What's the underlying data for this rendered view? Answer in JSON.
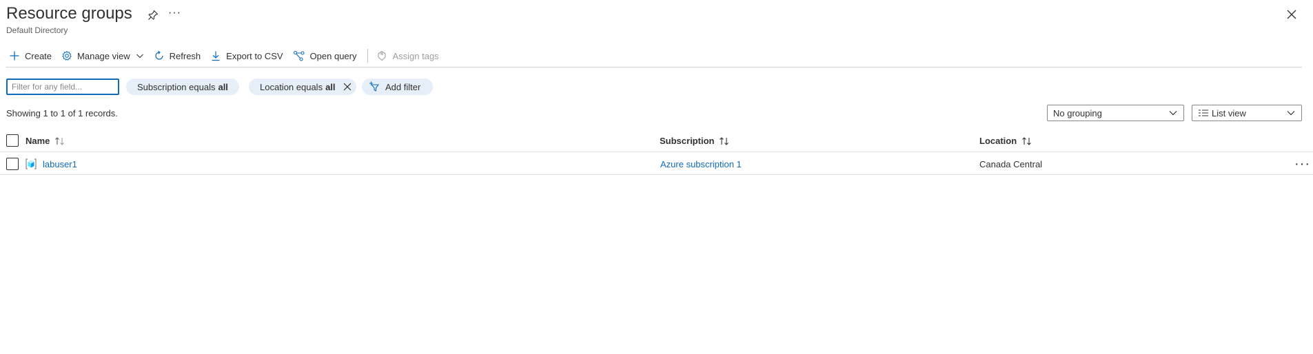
{
  "header": {
    "title": "Resource groups",
    "subtitle": "Default Directory",
    "more_label": "···"
  },
  "toolbar": {
    "create": "Create",
    "manage_view": "Manage view",
    "refresh": "Refresh",
    "export_csv": "Export to CSV",
    "open_query": "Open query",
    "assign_tags": "Assign tags"
  },
  "filters": {
    "search_placeholder": "Filter for any field...",
    "subscription_prefix": "Subscription equals",
    "subscription_value": "all",
    "location_prefix": "Location equals",
    "location_value": "all",
    "add_filter": "Add filter"
  },
  "records_text": "Showing 1 to 1 of 1 records.",
  "grouping": {
    "selected": "No grouping"
  },
  "view": {
    "selected": "List view"
  },
  "table": {
    "columns": [
      "Name",
      "Subscription",
      "Location"
    ],
    "rows": [
      {
        "name": "labuser1",
        "subscription": "Azure subscription 1",
        "location": "Canada Central"
      }
    ]
  },
  "row_more_label": "···",
  "colors": {
    "accent": "#0f6cbd",
    "pill_bg": "#e6eef8",
    "text": "#323130"
  },
  "icons": [
    "pin-icon",
    "more-icon",
    "close-icon",
    "plus-icon",
    "gear-icon",
    "chevron-down-icon",
    "refresh-icon",
    "download-icon",
    "query-icon",
    "tag-icon",
    "dismiss-icon",
    "add-filter-icon",
    "list-view-icon",
    "sort-icon",
    "resource-group-icon"
  ]
}
